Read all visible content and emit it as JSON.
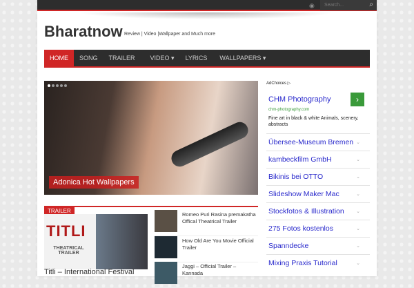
{
  "topbar": {
    "search_placeholder": "Search..."
  },
  "header": {
    "logo": "Bharatnow",
    "tagline": "Review | Video |Wallpaper and Much more"
  },
  "nav": [
    {
      "label": "HOME"
    },
    {
      "label": "SONG"
    },
    {
      "label": "TRAILER"
    },
    {
      "label": "VIDEO ▾"
    },
    {
      "label": "LYRICS"
    },
    {
      "label": "WALLPAPERS ▾"
    }
  ],
  "slider": {
    "caption": "Adonica Hot Wallpapers"
  },
  "trailer": {
    "section_label": "TRAILER",
    "thumb_title": "TITLI",
    "thumb_sub": "THEATRICAL TRAILER",
    "featured_title": "Titli – International Festival",
    "items": [
      {
        "title": "Romeo Puri Rasina premakatha Offical Theatrical Trailer"
      },
      {
        "title": "How Old Are You Movie Official Trailer"
      },
      {
        "title": "Jaggi – Official Trailer – Kannada"
      }
    ]
  },
  "sidebar": {
    "adchoices": "AdChoices ▷",
    "ad_title": "CHM Photography",
    "ad_url": "chm-photography.com",
    "ad_desc": "Fine art in black & white Animals, scenery, abstracts",
    "links": [
      {
        "label": "Übersee-Museum Bremen"
      },
      {
        "label": "kambeckfilm GmbH"
      },
      {
        "label": "Bikinis bei OTTO"
      },
      {
        "label": "Slideshow Maker Mac"
      },
      {
        "label": "Stockfotos & Illustration"
      },
      {
        "label": "275 Fotos kostenlos"
      },
      {
        "label": "Spanndecke"
      },
      {
        "label": "Mixing Praxis Tutorial"
      }
    ]
  }
}
